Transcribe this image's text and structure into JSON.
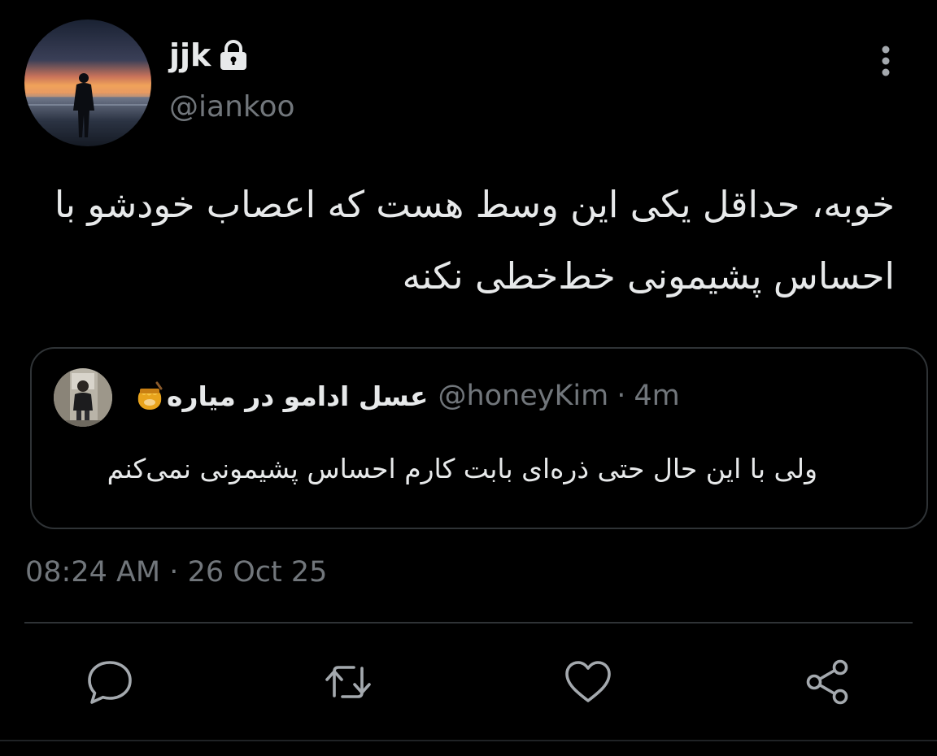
{
  "tweet": {
    "author": {
      "display_name": "jjk",
      "handle": "@iankoo",
      "protected_icon": "lock-icon"
    },
    "text": "خوبه، حداقل یکی این وسط هست که اعصاب خودشو با احساس پشیمونی خط‌خطی نکنه",
    "timestamp": "08:24 AM",
    "separator": "·",
    "date": "26 Oct 25"
  },
  "quoted_tweet": {
    "display_name": "عسل ادامو در میاره",
    "name_emoji_icon": "honey-pot-icon",
    "handle": "@honeyKim",
    "separator": "·",
    "time": "4m",
    "text": "ولی با این حال حتی ذره‌ای بابت کارم احساس پشیمونی نمی‌کنم"
  },
  "actions": {
    "reply_icon": "reply-icon",
    "retweet_icon": "retweet-icon",
    "like_icon": "heart-icon",
    "share_icon": "share-icon"
  },
  "colors": {
    "background": "#000000",
    "text_primary": "#e7e9ea",
    "text_secondary": "#71767b",
    "border": "#2f3336"
  }
}
